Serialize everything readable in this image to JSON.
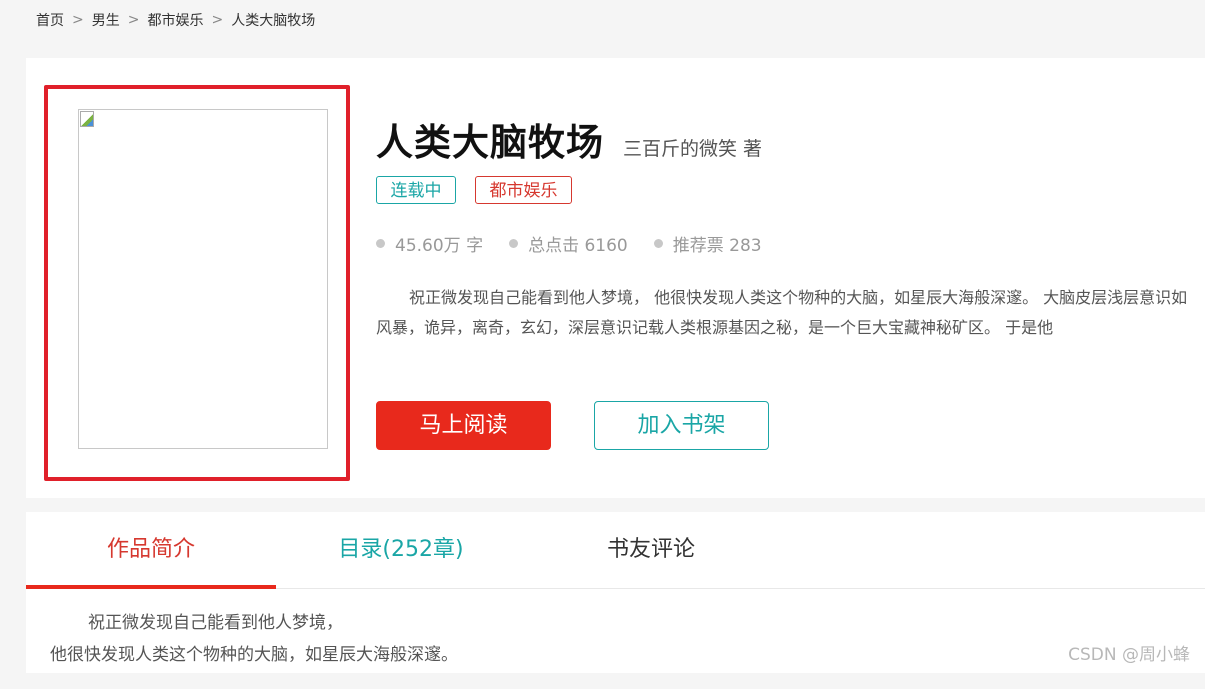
{
  "breadcrumb": {
    "items": [
      "首页",
      "男生",
      "都市娱乐",
      "人类大脑牧场"
    ],
    "separator": ">"
  },
  "book": {
    "title": "人类大脑牧场",
    "author": "三百斤的微笑  著",
    "tags": {
      "status": "连载中",
      "genre": "都市娱乐"
    },
    "stats": {
      "words": "45.60万 字",
      "clicks": "总点击 6160",
      "votes": "推荐票 283"
    },
    "intro": "祝正微发现自己能看到他人梦境， 他很快发现人类这个物种的大脑，如星辰大海般深邃。 大脑皮层浅层意识如风暴，诡异，离奇，玄幻，深层意识记载人类根源基因之秘，是一个巨大宝藏神秘矿区。 于是他"
  },
  "actions": {
    "read_label": "马上阅读",
    "shelf_label": "加入书架"
  },
  "tabs": {
    "intro_label": "作品简介",
    "toc_label": "目录(252章)",
    "comments_label": "书友评论"
  },
  "tab_content": {
    "line1": "祝正微发现自己能看到他人梦境，",
    "line2": "他很快发现人类这个物种的大脑，如星辰大海般深邃。"
  },
  "watermark": "CSDN @周小蜂",
  "colors": {
    "accent_red": "#e8291c",
    "accent_teal": "#1aa6a6",
    "highlight_frame": "#e0202a"
  }
}
